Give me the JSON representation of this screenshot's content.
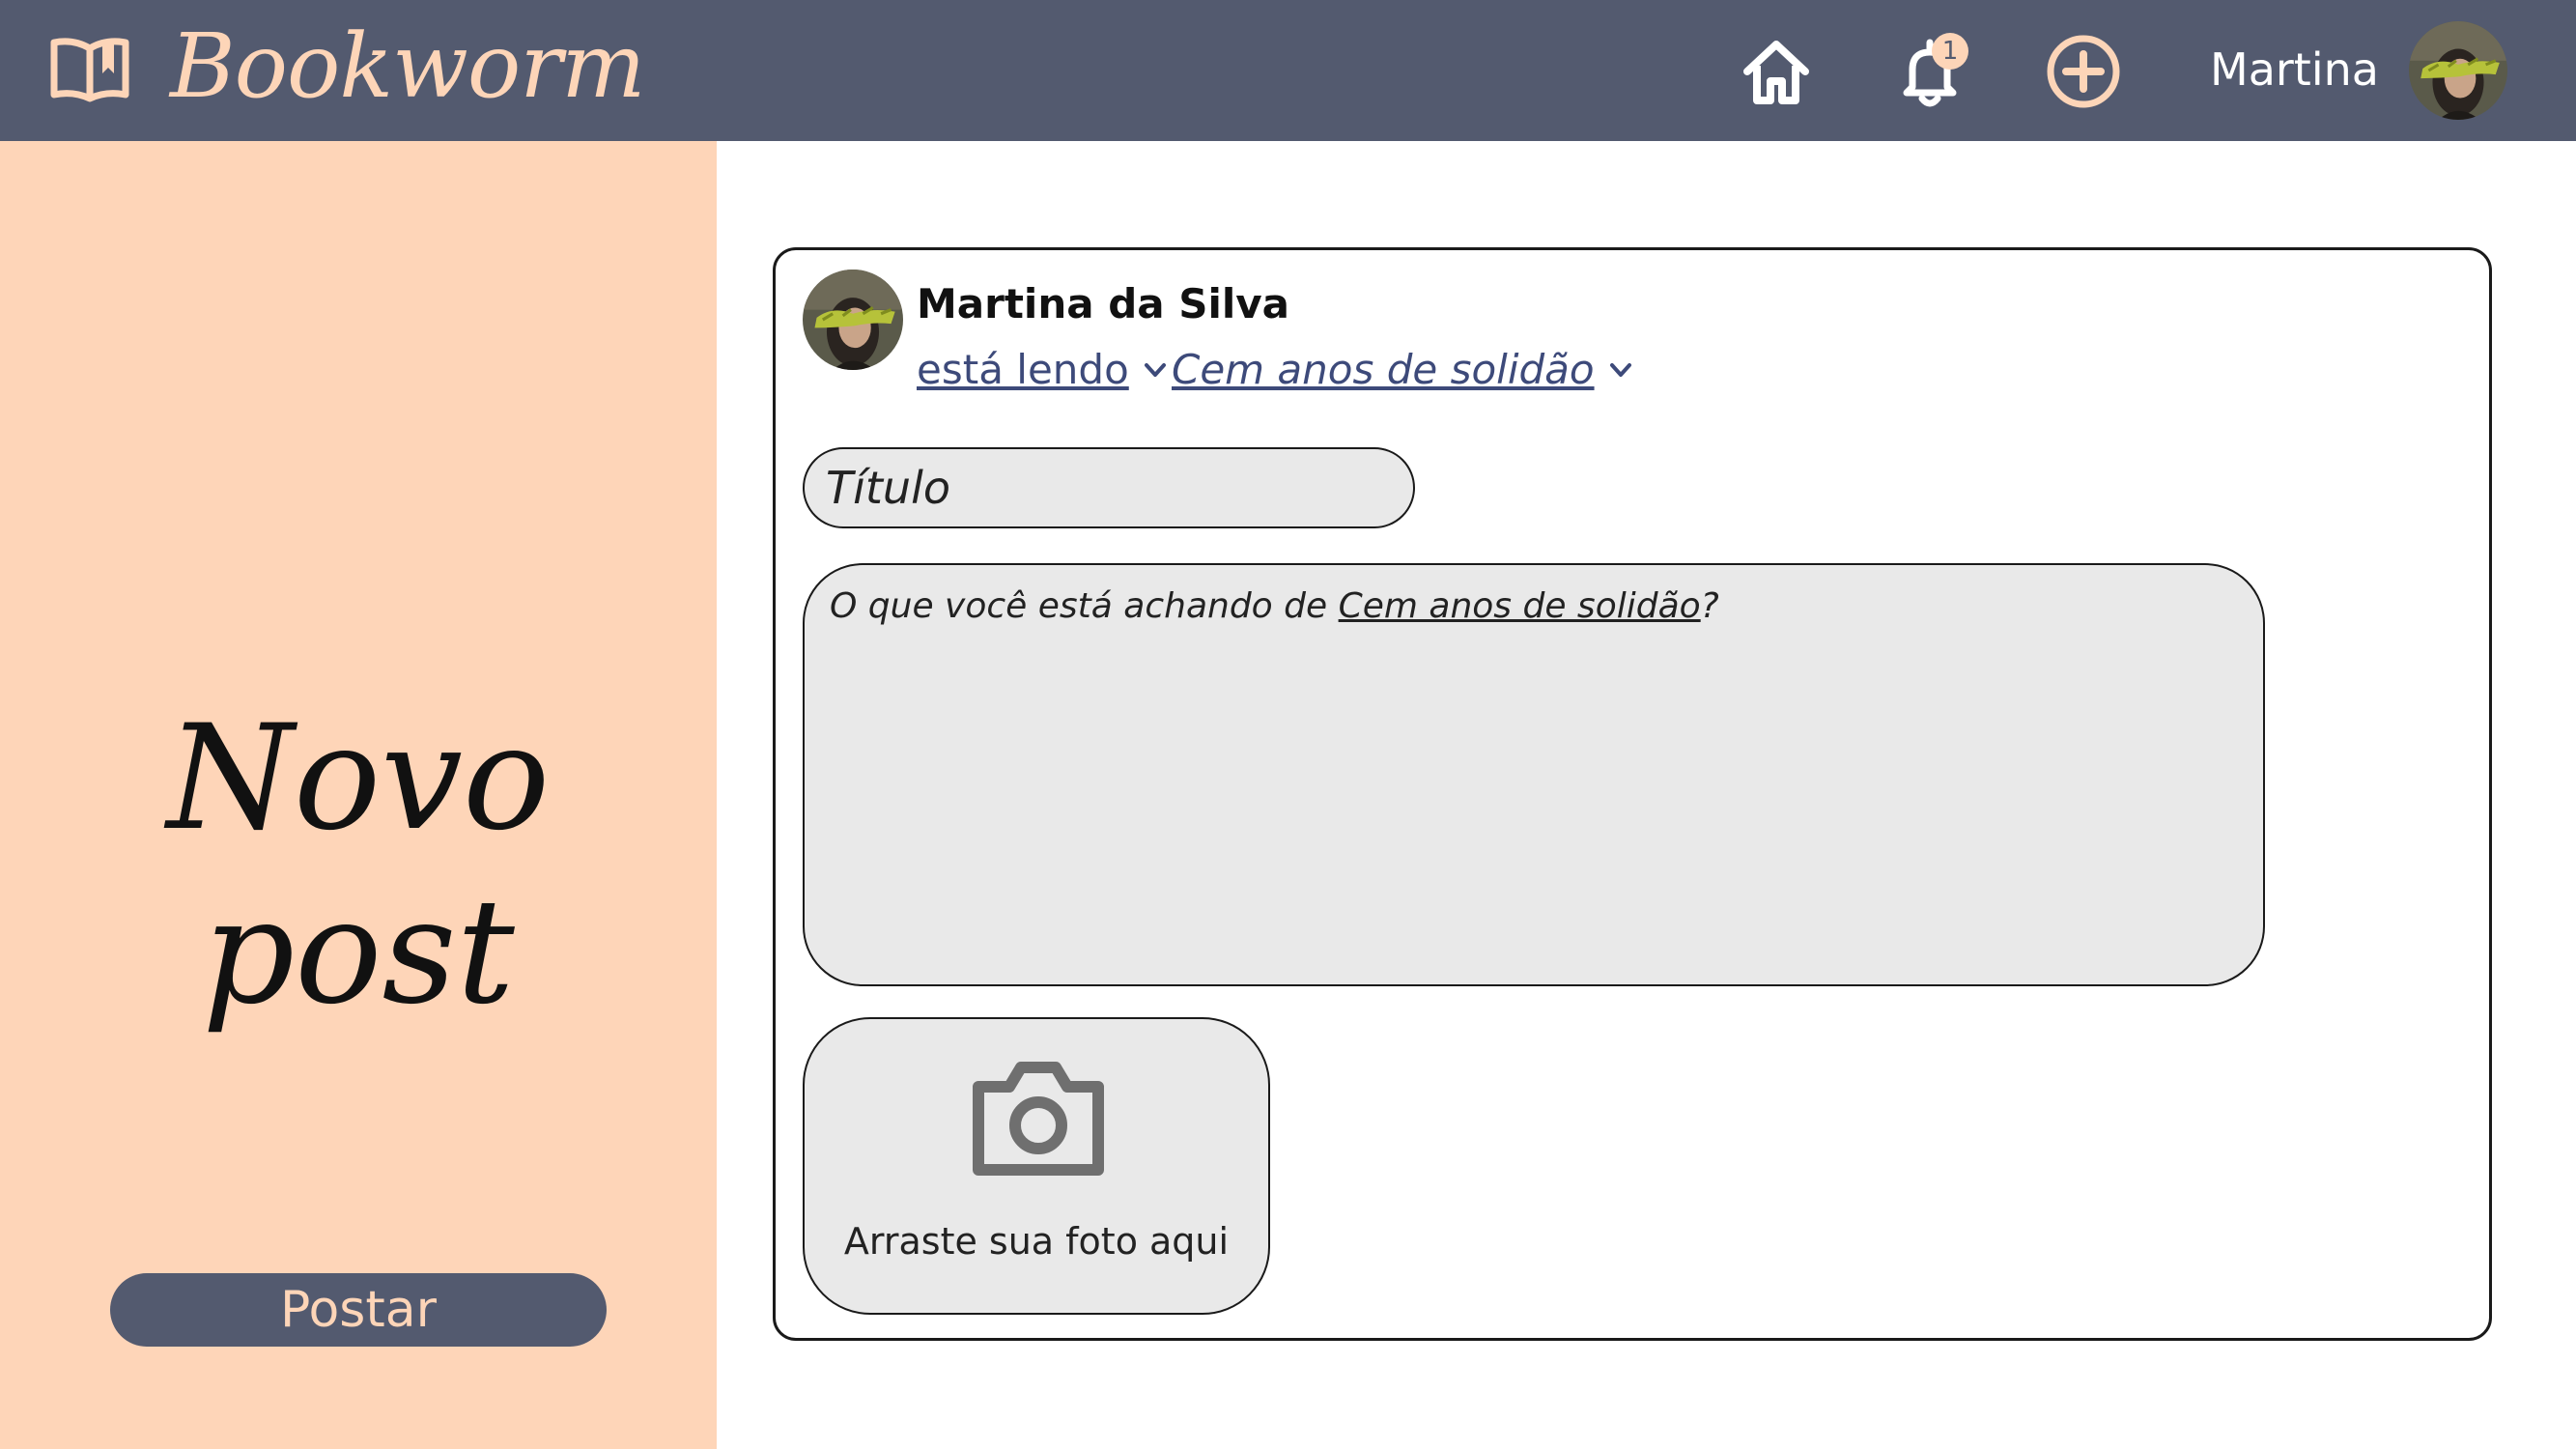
{
  "app": {
    "name": "Bookworm",
    "logo_icon": "open-book-icon"
  },
  "header": {
    "nav": {
      "home_icon": "home-icon",
      "notifications_icon": "bell-icon",
      "notification_count": "1",
      "create_icon": "plus-circle-icon"
    },
    "user": {
      "name": "Martina",
      "avatar": "user-avatar"
    }
  },
  "sidebar": {
    "title": "Novo post",
    "post_button": "Postar"
  },
  "post": {
    "author": "Martina da Silva",
    "status": "está lendo",
    "book": "Cem anos de solidão",
    "title_placeholder": "Título",
    "body_placeholder_prefix": "O que você está achando de ",
    "body_placeholder_book": "Cem anos de solidão",
    "body_placeholder_suffix": "?",
    "photo_icon": "camera-icon",
    "photo_label": "Arraste sua foto aqui"
  },
  "colors": {
    "header_bg": "#535a6f",
    "accent_peach": "#fed5b8",
    "link_blue": "#3d4a7a",
    "field_bg": "#e9e9e9"
  }
}
